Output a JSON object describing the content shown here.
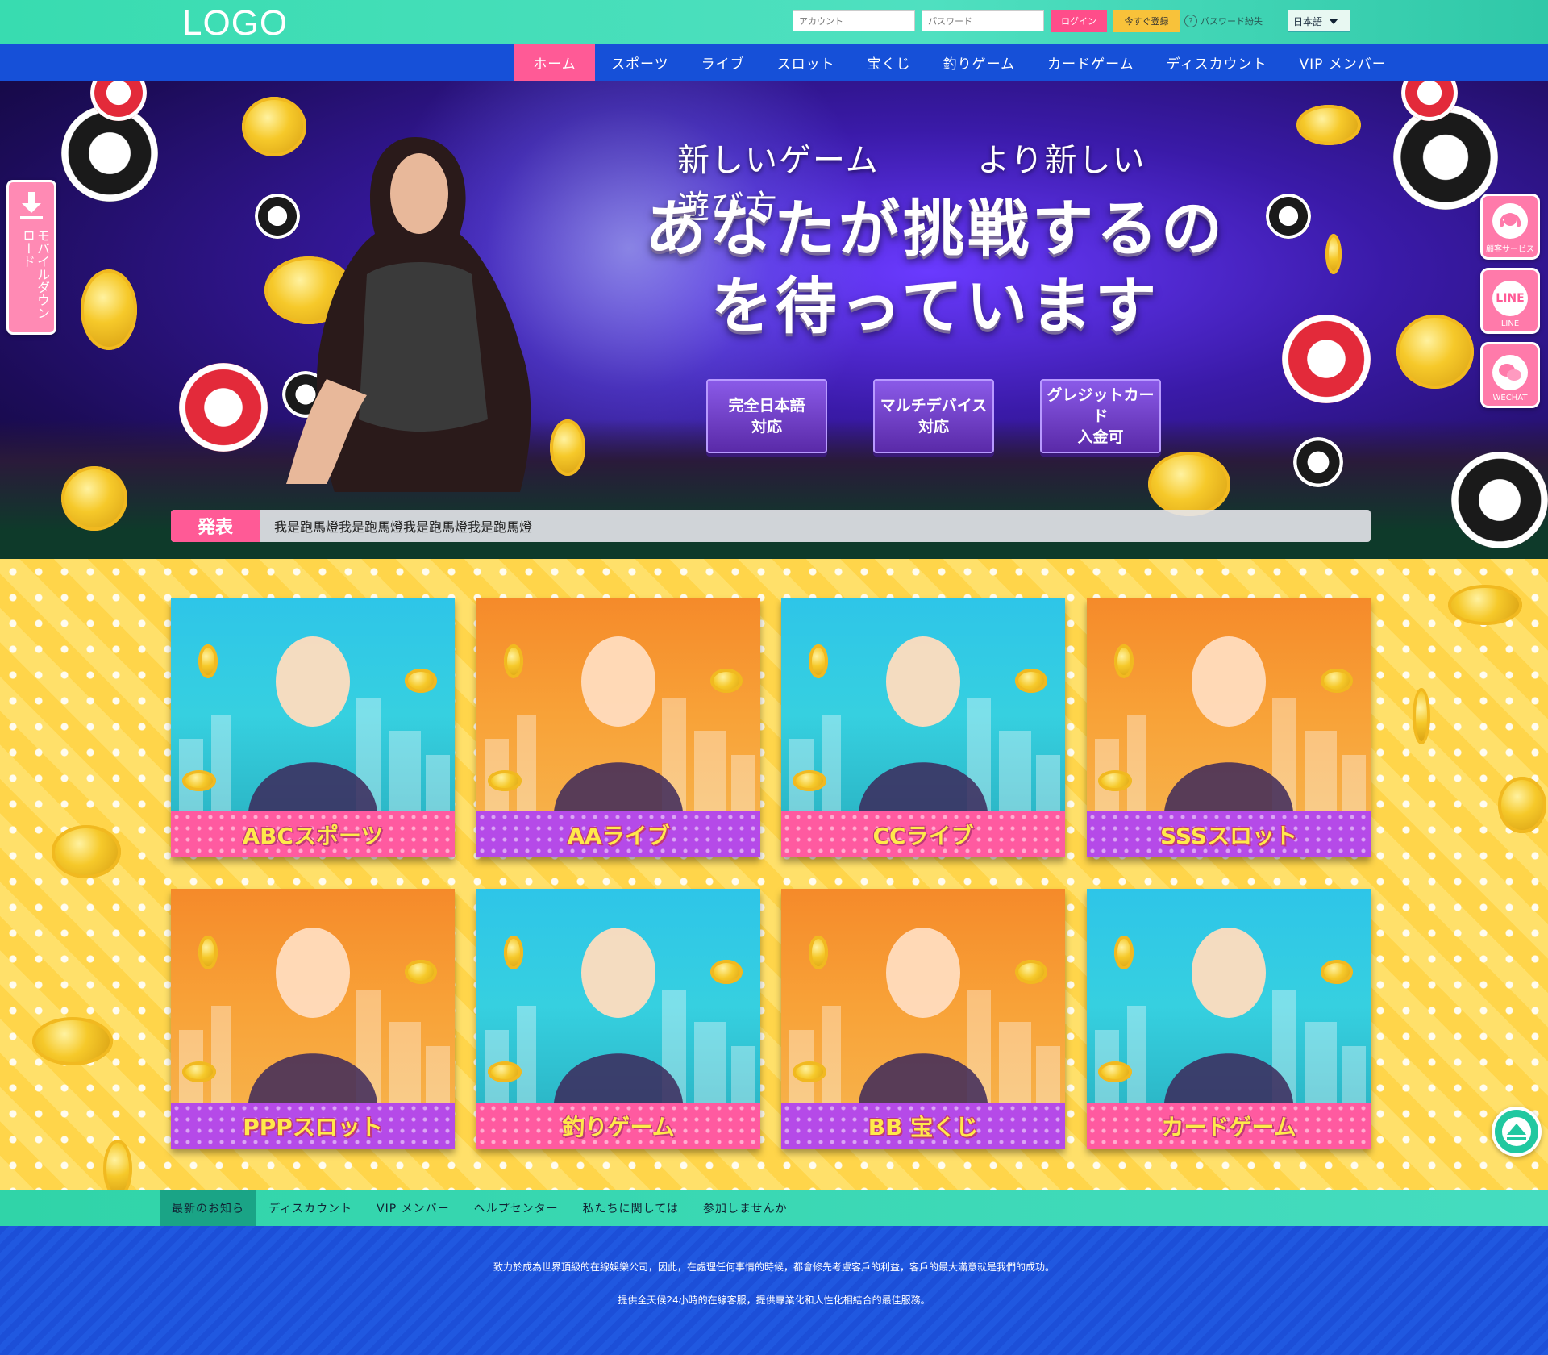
{
  "header": {
    "logo": "LOGO",
    "account_placeholder": "アカウント",
    "password_placeholder": "パスワード",
    "login_label": "ログイン",
    "register_label": "今すぐ登録",
    "forgot_label": "パスワード紛失",
    "language": "日本語"
  },
  "nav": {
    "items": [
      "ホーム",
      "スポーツ",
      "ライブ",
      "スロット",
      "宝くじ",
      "釣りゲーム",
      "カードゲーム",
      "ディスカウント",
      "VIP メンバー"
    ],
    "active_index": 0
  },
  "banner": {
    "subtitle_left": "新しいゲーム",
    "subtitle_right": "より新しい遊び方",
    "title_line1": "あなたが挑戦するの",
    "title_line2": "を待っています",
    "features": [
      "完全日本語\n対応",
      "マルチデバイス\n対応",
      "グレジットカード\n入金可"
    ],
    "ticker_label": "発表",
    "ticker_text": "我是跑馬燈我是跑馬燈我是跑馬燈我是跑馬燈"
  },
  "side": {
    "download_text": "モバイルダウンロード",
    "service_label": "顧客サービス",
    "line_label": "LINE",
    "line_icon_text": "LINE",
    "wechat_label": "WECHAT"
  },
  "games": [
    {
      "label": "ABCスポーツ",
      "art": "blue",
      "band": "pink"
    },
    {
      "label": "AAライブ",
      "art": "orange",
      "band": "purple"
    },
    {
      "label": "CCライブ",
      "art": "blue",
      "band": "pink"
    },
    {
      "label": "SSSスロット",
      "art": "orange",
      "band": "purple"
    },
    {
      "label": "PPPスロット",
      "art": "orange",
      "band": "purple"
    },
    {
      "label": "釣りゲーム",
      "art": "blue",
      "band": "pink"
    },
    {
      "label": "BB 宝くじ",
      "art": "orange",
      "band": "purple"
    },
    {
      "label": "カードゲーム",
      "art": "blue",
      "band": "pink"
    }
  ],
  "footer": {
    "nav": [
      "最新のお知ら",
      "ディスカウント",
      "VIP メンバー",
      "ヘルプセンター",
      "私たちに関しては",
      "参加しませんか"
    ],
    "line1": "致力於成為世界頂級的在線娛樂公司，因此，在處理任何事情的時候，都會修先考慮客戶的利益，客戶的最大滿意就是我們的成功。",
    "line2": "提供全天候24小時的在線客服，提供專業化和人性化相結合的最佳服務。"
  },
  "colors": {
    "header": "#38dcb0",
    "nav": "#1650d8",
    "accent_pink": "#ff5a96",
    "accent_purple": "#b54ae8",
    "background_yellow": "#ffd54a"
  }
}
